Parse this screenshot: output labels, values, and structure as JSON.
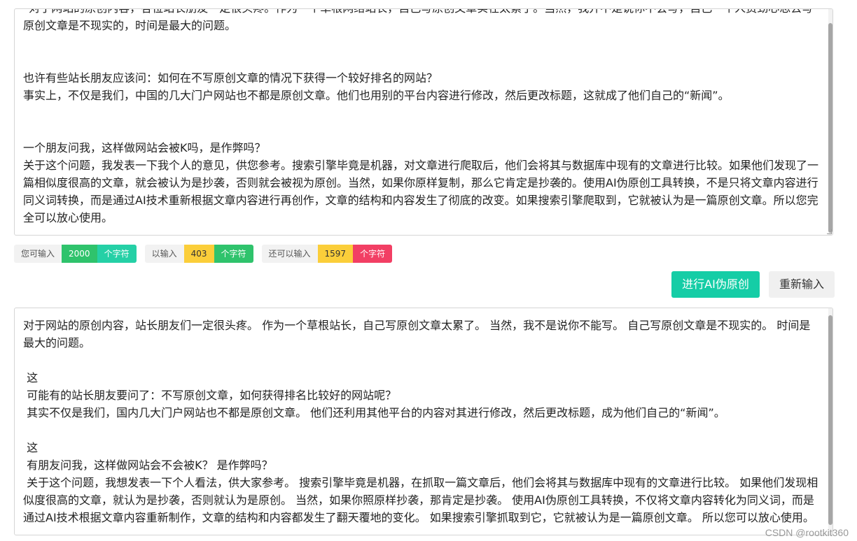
{
  "input": {
    "paragraphs": [
      "“对于网站的原创内容，各位站长朋友一定很头疼。作为一个草根网络站长，自己写原创文章实在太累了。当然，我并不是说你不会写，自己一个人费劲心思去写原创文章是不现实的，时间是最大的问题。",
      "",
      "",
      "也许有些站长朋友应该问：如何在不写原创文章的情况下获得一个较好排名的网站？",
      "事实上，不仅是我们，中国的几大门户网站也不都是原创文章。他们也用别的平台内容进行修改，然后更改标题，这就成了他们自己的“新闻”。",
      "",
      "",
      "一个朋友问我，这样做网站会被K吗，是作弊吗？",
      "关于这个问题，我发表一下我个人的意见，供您参考。搜索引擎毕竟是机器，对文章进行爬取后，他们会将其与数据库中现有的文章进行比较。如果他们发现了一篇相似度很高的文章，就会被认为是抄袭，否则就会被视为原创。当然，如果你原样复制，那么它肯定是抄袭的。使用AI伪原创工具转换，不是只将文章内容进行同义词转换，而是通过AI技术重新根据文章内容进行再创作，文章的结构和内容发生了彻底的改变。如果搜索引擎爬取到，它就被认为是一篇原创文章。所以您完全可以放心使用。"
    ]
  },
  "counters": {
    "can_input_label": "您可输入",
    "can_input_value": "2000",
    "already_label": "以输入",
    "already_value": "403",
    "remaining_label": "还可以输入",
    "remaining_value": "1597",
    "unit": "个字符"
  },
  "buttons": {
    "ai_label": "进行AI伪原创",
    "reset_label": "重新输入"
  },
  "output": {
    "paragraphs": [
      "对于网站的原创内容，站长朋友们一定很头疼。 作为一个草根站长，自己写原创文章太累了。 当然，我不是说你不能写。 自己写原创文章是不现实的。 时间是最大的问题。",
      "",
      " 这",
      " 可能有的站长朋友要问了：不写原创文章，如何获得排名比较好的网站呢？",
      " 其实不仅是我们，国内几大门户网站也不都是原创文章。 他们还利用其他平台的内容对其进行修改，然后更改标题，成为他们自己的“新闻”。",
      "",
      " 这",
      " 有朋友问我，这样做网站会不会被K？ 是作弊吗？",
      " 关于这个问题，我想发表一下个人看法，供大家参考。 搜索引擎毕竟是机器，在抓取一篇文章后，他们会将其与数据库中现有的文章进行比较。 如果他们发现相似度很高的文章，就认为是抄袭，否则就认为是原创。 当然，如果你照原样抄袭，那肯定是抄袭。 使用AI伪原创工具转换，不仅将文章内容转化为同义词，而是通过AI技术根据文章内容重新制作，文章的结构和内容都发生了翻天覆地的变化。 如果搜索引擎抓取到它，它就被认为是一篇原创文章。 所以您可以放心使用。"
    ]
  },
  "watermark": "CSDN @rootkit360",
  "colors": {
    "accent": "#15cda6",
    "green": "#2fc36c",
    "yellow": "#fbce3a",
    "red": "#f23f64",
    "teal": "#25d0a6"
  }
}
